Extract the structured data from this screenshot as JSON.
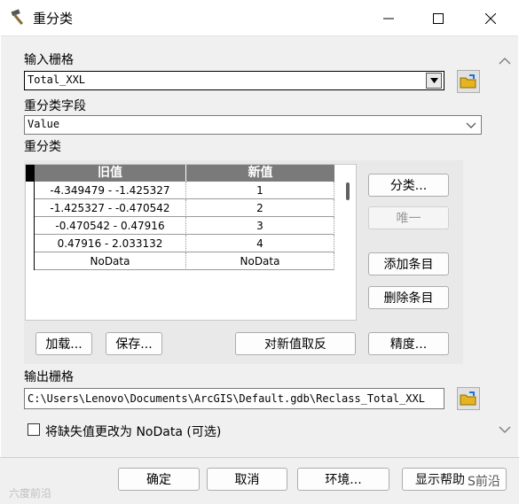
{
  "window": {
    "title": "重分类",
    "icon": "hammer-icon"
  },
  "input_raster": {
    "label": "输入栅格",
    "value": "Total_XXL"
  },
  "reclass_field": {
    "label": "重分类字段",
    "value": "Value"
  },
  "reclassification": {
    "label": "重分类",
    "columns": [
      "旧值",
      "新值"
    ],
    "rows": [
      {
        "old": "-4.349479 - -1.425327",
        "new": "1"
      },
      {
        "old": "-1.425327 - -0.470542",
        "new": "2"
      },
      {
        "old": "-0.470542 - 0.47916",
        "new": "3"
      },
      {
        "old": "0.47916 - 2.033132",
        "new": "4"
      },
      {
        "old": "NoData",
        "new": "NoData"
      }
    ],
    "buttons": {
      "classify": "分类...",
      "unique": "唯一",
      "add_entry": "添加条目",
      "delete_entry": "删除条目",
      "load": "加载...",
      "save": "保存...",
      "reverse": "对新值取反",
      "precision": "精度..."
    }
  },
  "output_raster": {
    "label": "输出栅格",
    "value": "C:\\Users\\Lenovo\\Documents\\ArcGIS\\Default.gdb\\Reclass_Total_XXL"
  },
  "nodata_option": {
    "label": "将缺失值更改为 NoData (可选)",
    "checked": false
  },
  "footer": {
    "ok": "确定",
    "cancel": "取消",
    "environments": "环境...",
    "help": "显示帮助"
  },
  "watermark": {
    "left": "六度前沿",
    "right": "S前沿"
  }
}
